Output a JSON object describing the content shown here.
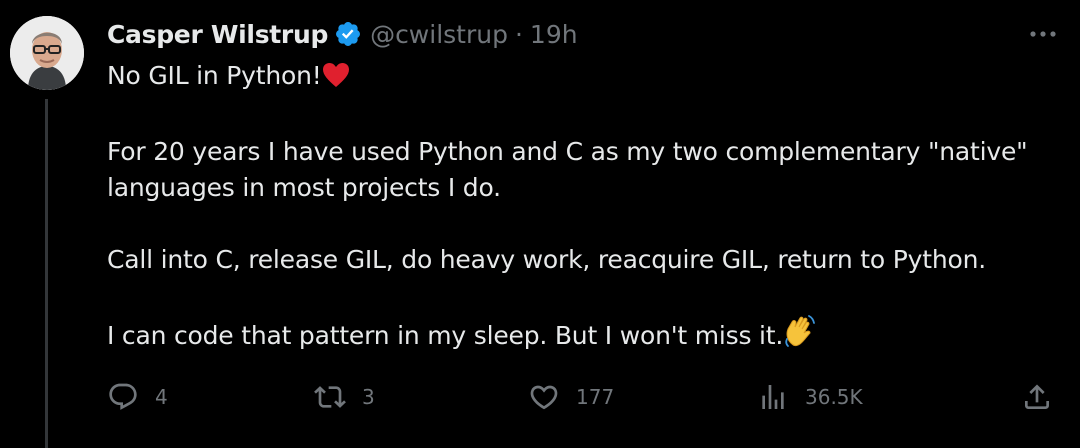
{
  "author": {
    "display_name": "Casper Wilstrup",
    "handle": "@cwilstrup",
    "separator": "·",
    "time": "19h",
    "verified": true,
    "verified_color": "#1d9bf0"
  },
  "tweet": {
    "lines": [
      "No GIL in Python!",
      "For 20 years I have used Python and C as my two complementary \"native\"",
      "languages in most projects I do.",
      "Call into C, release GIL, do heavy work, reacquire GIL, return to Python.",
      "I can code that pattern in my sleep. But I won't miss it."
    ],
    "emojis": [
      "red-heart",
      "waving-hand"
    ]
  },
  "actions": {
    "replies": "4",
    "retweets": "3",
    "likes": "177",
    "views": "36.5K"
  },
  "colors": {
    "background": "#000000",
    "text": "#e7e9ea",
    "muted": "#71767b",
    "thread_line": "#333639"
  }
}
